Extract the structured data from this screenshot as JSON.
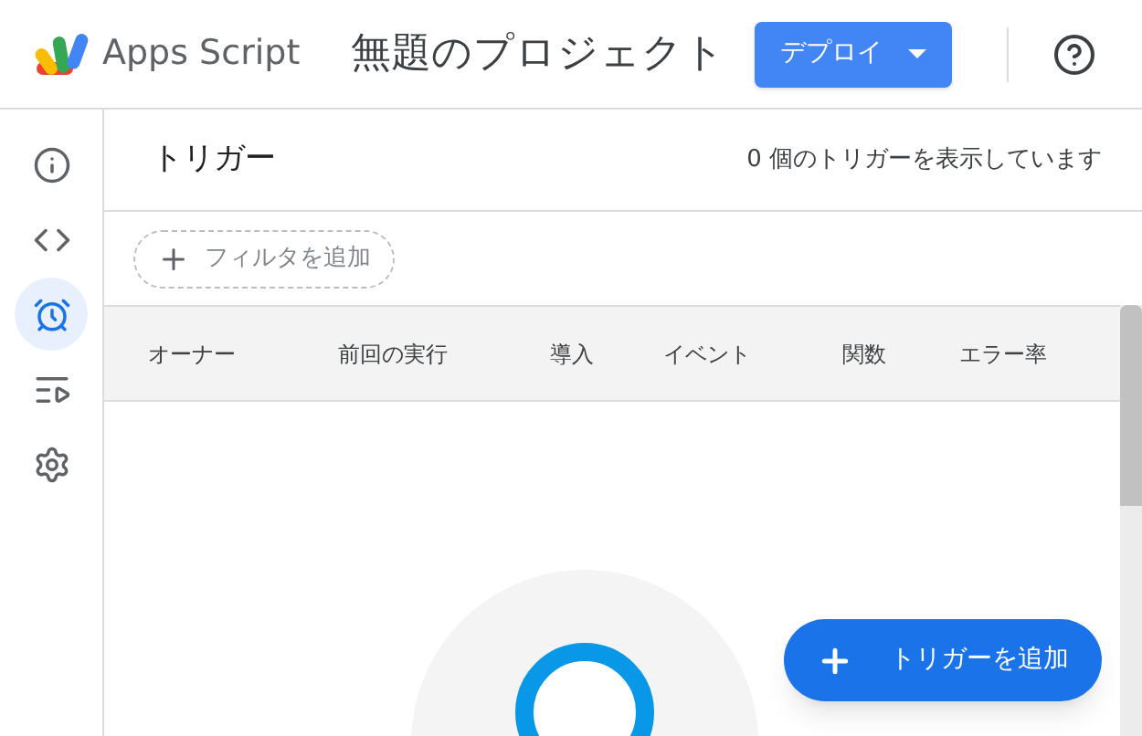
{
  "header": {
    "app_name": "Apps Script",
    "project_title": "無題のプロジェクト",
    "deploy_button": "デプロイ"
  },
  "sidebar": {
    "items": [
      {
        "kind": "info",
        "selected": false
      },
      {
        "kind": "code",
        "selected": false
      },
      {
        "kind": "clock",
        "selected": true
      },
      {
        "kind": "runs",
        "selected": false
      },
      {
        "kind": "settings",
        "selected": false
      }
    ]
  },
  "page": {
    "title": "トリガー",
    "count_text": "0 個のトリガーを表示しています",
    "filter_button": "フィルタを追加"
  },
  "table": {
    "columns": [
      "オーナー",
      "前回の実行",
      "導入",
      "イベント",
      "関数",
      "エラー率"
    ]
  },
  "fab": {
    "label": "トリガーを追加"
  }
}
